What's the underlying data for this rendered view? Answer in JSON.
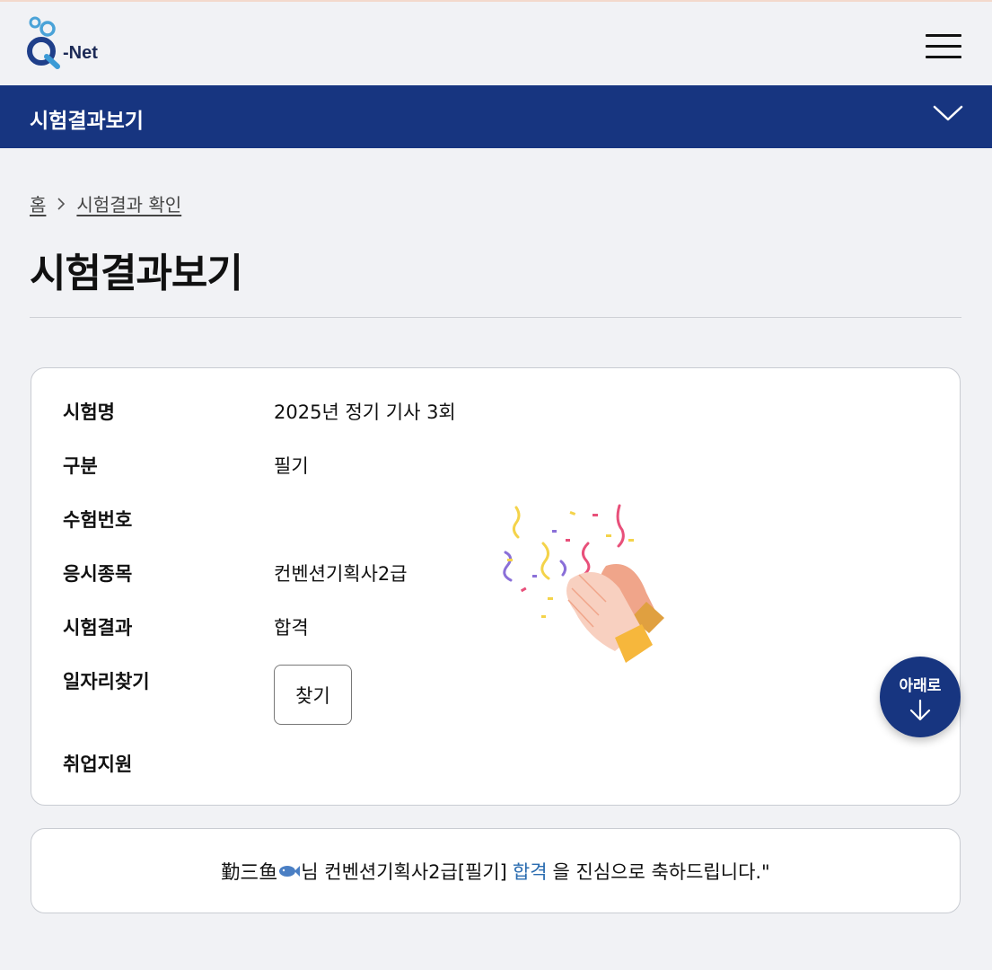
{
  "header": {
    "logo_text": "-Net",
    "logo_letter": "Q"
  },
  "navbar": {
    "title": "시험결과보기"
  },
  "breadcrumb": {
    "home": "홈",
    "current": "시험결과 확인"
  },
  "page_title": "시험결과보기",
  "result": {
    "rows": [
      {
        "label": "시험명",
        "value": "2025년 정기 기사 3회"
      },
      {
        "label": "구분",
        "value": "필기"
      },
      {
        "label": "수험번호",
        "value": ""
      },
      {
        "label": "응시종목",
        "value": "컨벤션기획사2급"
      },
      {
        "label": "시험결과",
        "value": "합격"
      },
      {
        "label": "일자리찾기",
        "value": ""
      },
      {
        "label": "취업지원",
        "value": ""
      }
    ],
    "find_button": "찾기"
  },
  "fab": {
    "label": "아래로"
  },
  "message": {
    "name": "勤三鱼",
    "name_suffix": "님 컨벤션기획사2급[필기]",
    "highlight": "합격",
    "tail": "을 진심으로 축하드립니다.\""
  },
  "colors": {
    "brand_navy": "#173580",
    "page_bg": "#f1f2f5",
    "link_blue": "#2a6cb0"
  }
}
